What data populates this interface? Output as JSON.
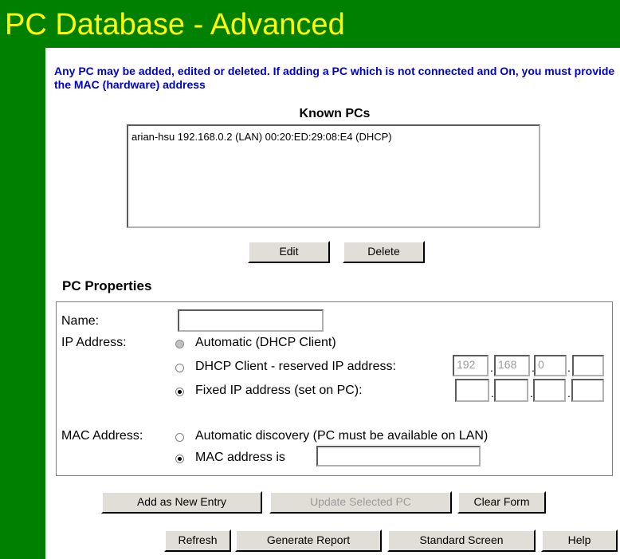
{
  "title": "PC Database - Advanced",
  "intro": "Any PC may be added, edited or deleted. If adding a PC which is not connected and On, you must provide the MAC (hardware) address",
  "known_pcs": {
    "title": "Known PCs",
    "items": [
      "arian-hsu 192.168.0.2 (LAN) 00:20:ED:29:08:E4 (DHCP)"
    ],
    "edit_label": "Edit",
    "delete_label": "Delete"
  },
  "properties": {
    "title": "PC Properties",
    "name_label": "Name:",
    "name_value": "",
    "ip_label": "IP Address:",
    "ip_auto_label": "Automatic (DHCP Client)",
    "ip_reserved_label": "DHCP Client - reserved IP address:",
    "ip_reserved_octets": [
      "192",
      "168",
      "0",
      ""
    ],
    "ip_fixed_label": "Fixed IP address (set on PC):",
    "ip_fixed_octets": [
      "",
      "",
      "",
      ""
    ],
    "ip_selected": "fixed",
    "mac_label": "MAC Address:",
    "mac_auto_label": "Automatic discovery (PC must be available on LAN)",
    "mac_manual_label": "MAC address is",
    "mac_value": "",
    "mac_selected": "manual"
  },
  "actions": {
    "add_label": "Add as New Entry",
    "update_label": "Update Selected PC",
    "clear_label": "Clear Form"
  },
  "footer": {
    "refresh_label": "Refresh",
    "report_label": "Generate Report",
    "standard_label": "Standard Screen",
    "help_label": "Help"
  },
  "colors": {
    "header_bg": "#008000",
    "title_text": "#ffff00",
    "intro_text": "#0000cc"
  }
}
